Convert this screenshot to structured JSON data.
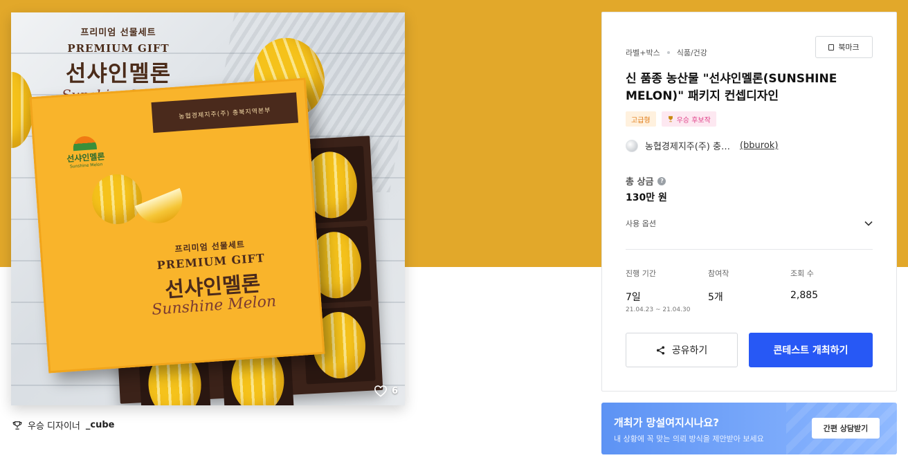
{
  "image": {
    "top": {
      "small": "프리미엄 선물세트",
      "gift": "PREMIUM GIFT",
      "big": "선샤인멜론",
      "script": "Sunshine Melon"
    },
    "box": {
      "band": "농협경제지주(주) 충북지역본부",
      "logo_text": "선샤인멜론",
      "logo_sub": "Sunshine Melon",
      "small": "프리미엄 선물세트",
      "gift": "PREMIUM GIFT",
      "big": "선샤인멜론",
      "script": "Sunshine Melon"
    },
    "likes": "6",
    "icons": {
      "like": "heart-icon"
    }
  },
  "winner": {
    "prefix": "우승 디자이너",
    "name": "_cube",
    "icon": "trophy-icon"
  },
  "panel": {
    "breadcrumb": [
      "라벨+박스",
      "식품/건강"
    ],
    "bookmark_label": "북마크",
    "title": "신 품종 농산물 \"선샤인멜론(SUNSHINE MELON)\" 패키지 컨셉디자인",
    "tags": {
      "grade": "고급형",
      "award": "우승 후보작"
    },
    "author": {
      "name": "농협경제지주(주) 충…",
      "handle": "(bburok)"
    },
    "prize": {
      "label": "총 상금",
      "value": "130만 원"
    },
    "options_label": "사용 옵션",
    "stats": {
      "period": {
        "label": "진행 기간",
        "value": "7일",
        "range": "21.04.23 ~ 21.04.30"
      },
      "entries": {
        "label": "참여작",
        "value": "5개"
      },
      "views": {
        "label": "조회 수",
        "value": "2,885"
      }
    },
    "share_label": "공유하기",
    "host_label": "콘테스트 개최하기"
  },
  "banner": {
    "heading": "개최가 망설여지시나요?",
    "text": "내 상황에 꼭 맞는 의뢰 방식을 제안받아 보세요",
    "button": "간편 상담받기"
  },
  "colors": {
    "hero": "#e2a82a",
    "primary": "#2758f5",
    "banner": "#5d93f4"
  }
}
